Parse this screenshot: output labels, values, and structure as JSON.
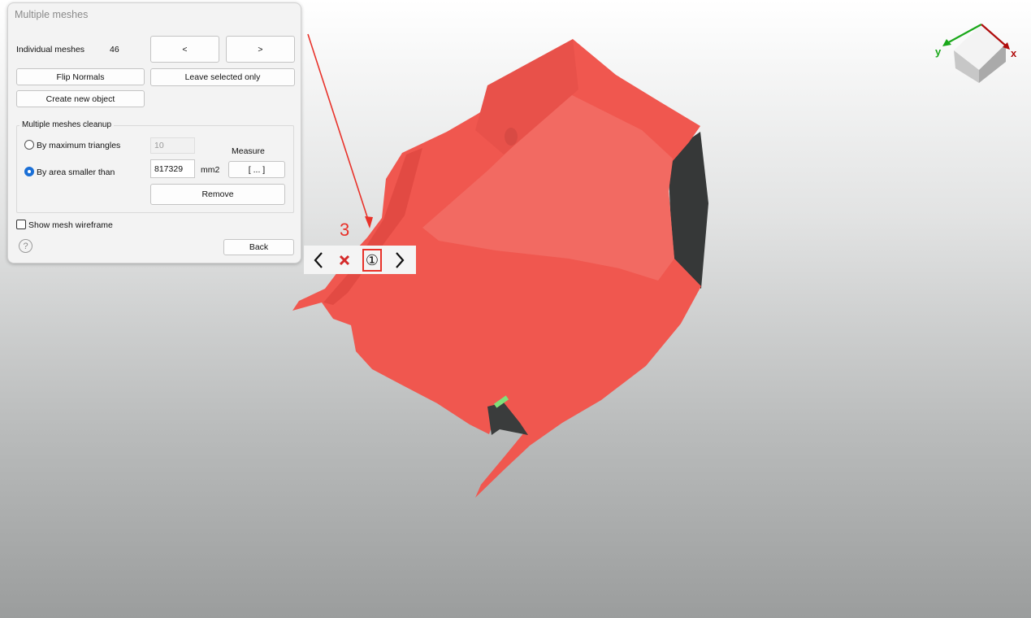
{
  "panel": {
    "title": "Multiple meshes",
    "individual_meshes_label": "Individual meshes",
    "individual_meshes_count": "46",
    "prev_label": "<",
    "next_label": ">",
    "flip_normals_label": "Flip Normals",
    "leave_selected_label": "Leave selected only",
    "create_object_label": "Create new object",
    "cleanup": {
      "title": "Multiple meshes cleanup",
      "max_triangles_label": "By maximum triangles",
      "max_triangles_value": "10",
      "area_label": "By area smaller than",
      "area_value": "817329",
      "area_unit": "mm2",
      "measure_label": "Measure",
      "measure_button": "[ ... ]",
      "remove_label": "Remove",
      "selected_option": "area"
    },
    "wireframe_label": "Show mesh wireframe",
    "wireframe_checked": false,
    "help_icon": "?",
    "back_label": "Back"
  },
  "annotation": {
    "step_number": "3",
    "color": "#e8322a"
  },
  "toolbar": {
    "icons": [
      "chevron-left-icon",
      "close-icon",
      "circled-one-icon",
      "chevron-right-icon"
    ],
    "circled_number": "①"
  },
  "axes": {
    "x_label": "x",
    "y_label": "y",
    "x_color": "#b00d0d",
    "y_color": "#1aa81a"
  },
  "colors": {
    "mesh_selected": "#f0574f",
    "mesh_unselected": "#3a3c3c",
    "accent": "#1a6fd6"
  }
}
